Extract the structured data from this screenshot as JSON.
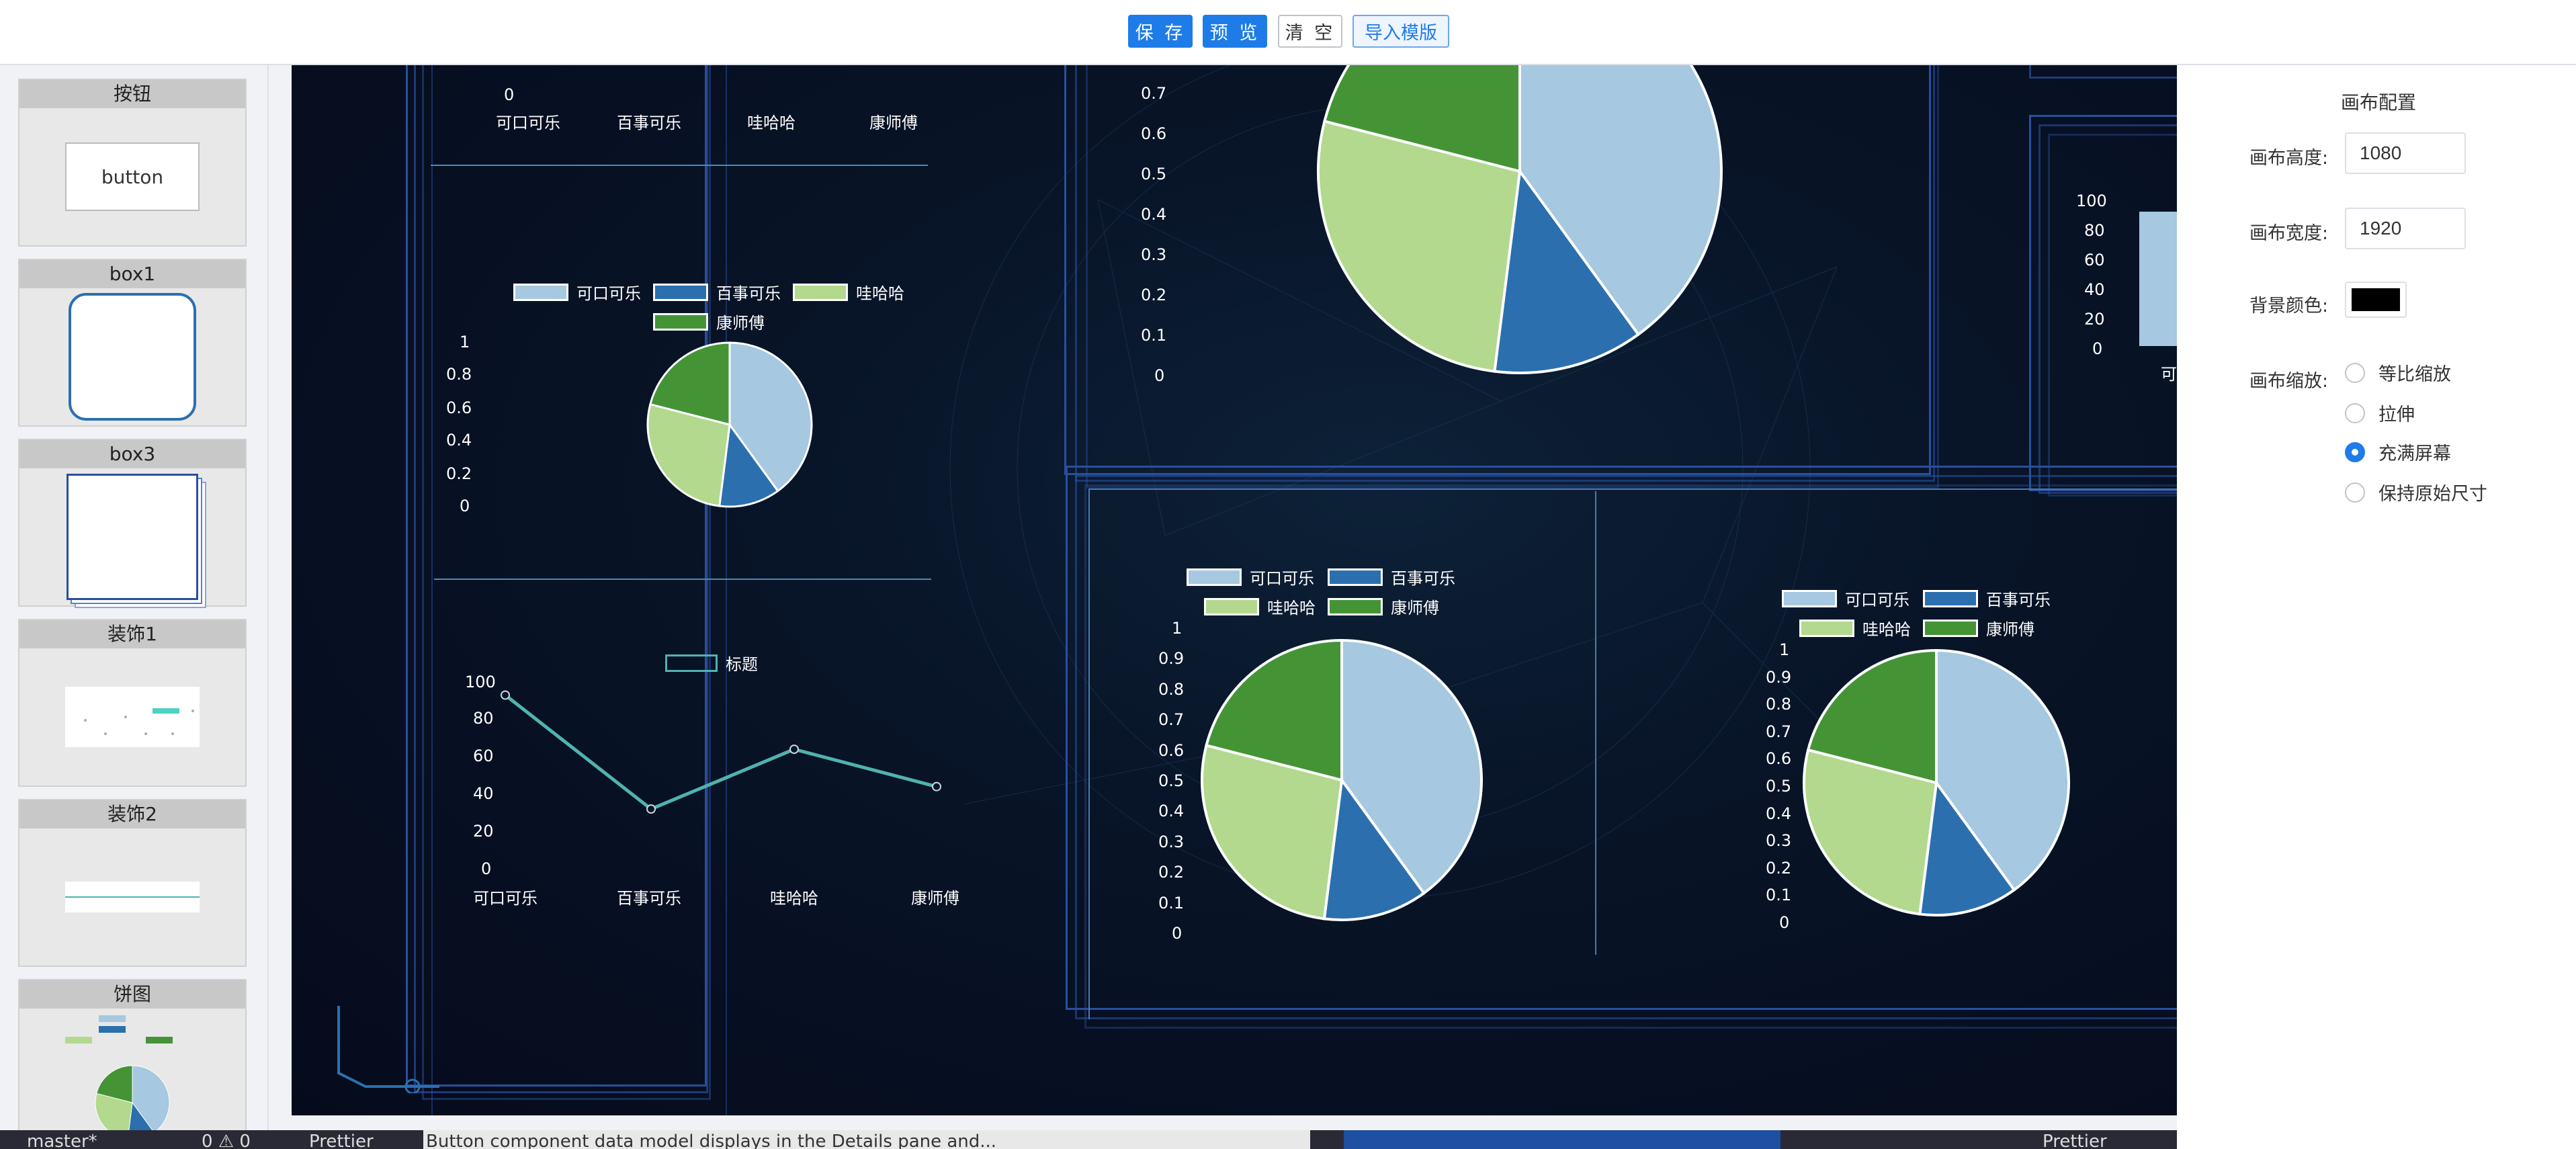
{
  "toolbar": {
    "save": "保 存",
    "preview": "预 览",
    "clear": "清 空",
    "import_template": "导入模版"
  },
  "palette": {
    "items": [
      {
        "label": "按钮",
        "preview_text": "button"
      },
      {
        "label": "box1"
      },
      {
        "label": "box3"
      },
      {
        "label": "装饰1"
      },
      {
        "label": "装饰2"
      },
      {
        "label": "饼图"
      }
    ]
  },
  "canvas": {
    "background_color": "#000000",
    "legend_labels": [
      "可口可乐",
      "百事可乐",
      "哇哈哈",
      "康师傅"
    ],
    "colors": [
      "#a6c8e0",
      "#2c6fae",
      "#b2d98e",
      "#449436"
    ],
    "bar_chart_top": {
      "y_tick_zero": "0",
      "categories": [
        "可口可乐",
        "百事可乐",
        "哇哈哈",
        "康师傅"
      ]
    },
    "small_pie": {
      "y_ticks": [
        "1",
        "0.8",
        "0.6",
        "0.4",
        "0.2",
        "0"
      ]
    },
    "line_chart": {
      "legend": "标题",
      "y_ticks": [
        "100",
        "80",
        "60",
        "40",
        "20",
        "0"
      ],
      "categories": [
        "可口可乐",
        "百事可乐",
        "哇哈哈",
        "康师傅"
      ],
      "line_color": "#4fb3b0"
    },
    "big_pie": {
      "y_ticks": [
        "0.7",
        "0.6",
        "0.5",
        "0.4",
        "0.3",
        "0.2",
        "0.1",
        "0"
      ]
    },
    "pie_ticks_full": [
      "1",
      "0.9",
      "0.8",
      "0.7",
      "0.6",
      "0.5",
      "0.4",
      "0.3",
      "0.2",
      "0.1",
      "0"
    ],
    "right_bar": {
      "y_ticks": [
        "100",
        "80",
        "60",
        "40",
        "20",
        "0"
      ],
      "x_label_partial": "可"
    }
  },
  "chart_data": [
    {
      "type": "pie",
      "categories": [
        "可口可乐",
        "百事可乐",
        "哇哈哈",
        "康师傅"
      ],
      "values": [
        40,
        12,
        27,
        21
      ]
    },
    {
      "type": "line",
      "categories": [
        "可口可乐",
        "百事可乐",
        "哇哈哈",
        "康师傅"
      ],
      "values": [
        93,
        32,
        64,
        44
      ],
      "series": [
        {
          "name": "标题",
          "values": [
            93,
            32,
            64,
            44
          ]
        }
      ],
      "ylim": [
        0,
        100
      ]
    }
  ],
  "config": {
    "title": "画布配置",
    "height_label": "画布高度:",
    "height_value": "1080",
    "width_label": "画布宽度:",
    "width_value": "1920",
    "bg_label": "背景颜色:",
    "bg_color": "#000000",
    "scale_label": "画布缩放:",
    "scale_options": [
      "等比缩放",
      "拉伸",
      "充满屏幕",
      "保持原始尺寸"
    ],
    "scale_selected": "充满屏幕"
  },
  "status": {
    "branch": "master*",
    "errors": "0 ⚠ 0",
    "prettier": "Prettier",
    "message": "Button component data model displays in the Details pane and...",
    "right": "Prettier"
  }
}
